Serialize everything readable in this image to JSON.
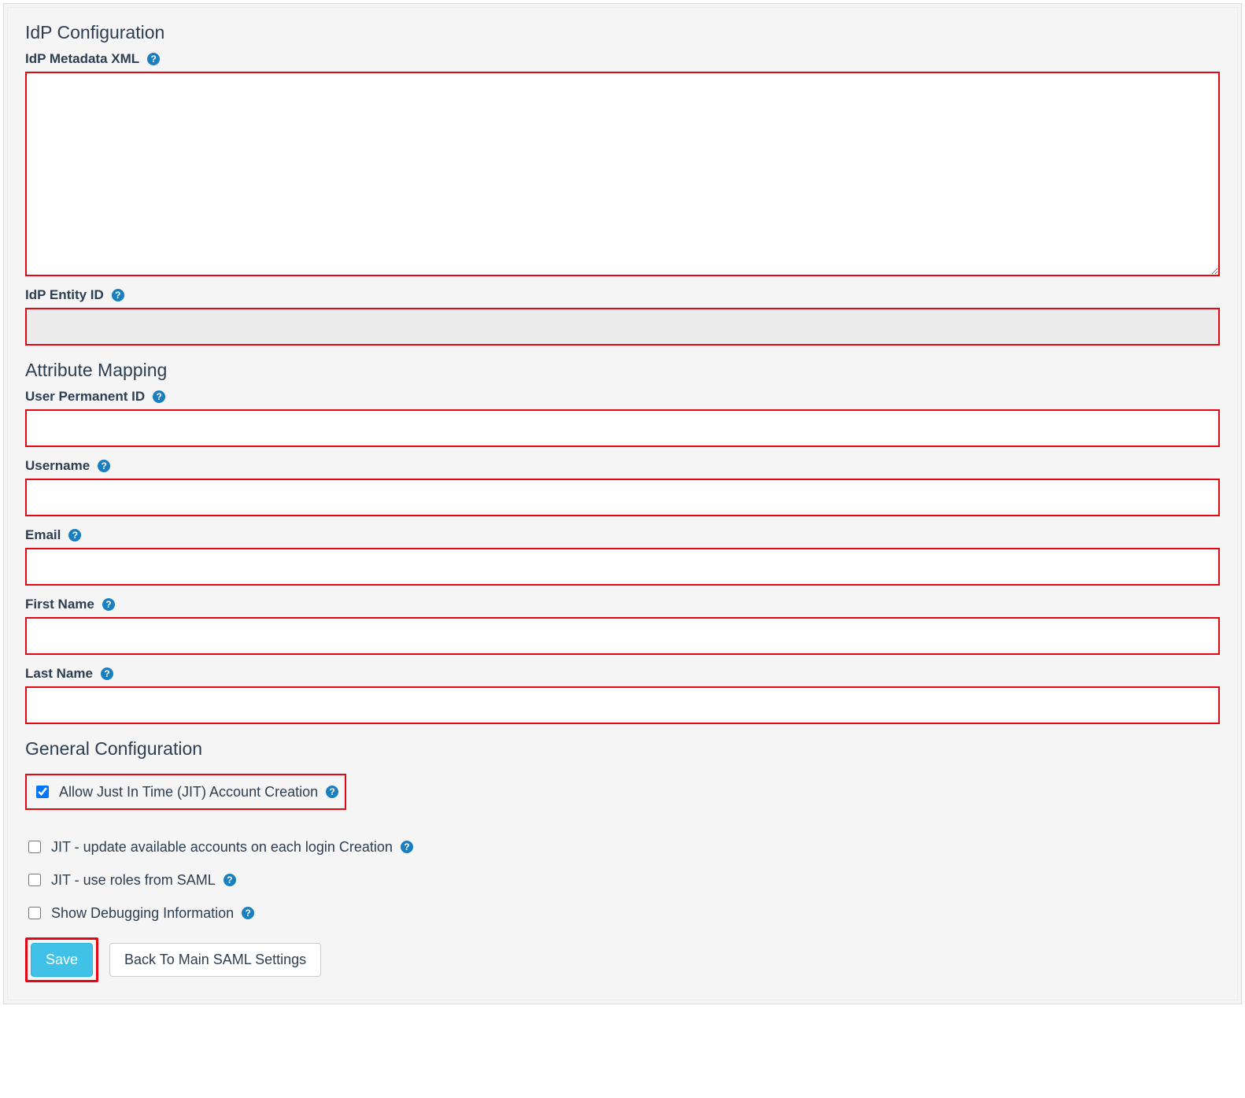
{
  "sections": {
    "idp_config_title": "IdP Configuration",
    "attribute_mapping_title": "Attribute Mapping",
    "general_config_title": "General Configuration"
  },
  "fields": {
    "idp_metadata_xml": {
      "label": "IdP Metadata XML",
      "value": ""
    },
    "idp_entity_id": {
      "label": "IdP Entity ID",
      "value": ""
    },
    "user_permanent_id": {
      "label": "User Permanent ID",
      "value": ""
    },
    "username": {
      "label": "Username",
      "value": ""
    },
    "email": {
      "label": "Email",
      "value": ""
    },
    "first_name": {
      "label": "First Name",
      "value": ""
    },
    "last_name": {
      "label": "Last Name",
      "value": ""
    }
  },
  "checkboxes": {
    "jit_creation": {
      "label": "Allow Just In Time (JIT) Account Creation",
      "checked": true
    },
    "jit_update": {
      "label": "JIT - update available accounts on each login Creation",
      "checked": false
    },
    "jit_roles": {
      "label": "JIT - use roles from SAML",
      "checked": false
    },
    "show_debug": {
      "label": "Show Debugging Information",
      "checked": false
    }
  },
  "buttons": {
    "save": "Save",
    "back": "Back To Main SAML Settings"
  },
  "help_glyph": "?"
}
